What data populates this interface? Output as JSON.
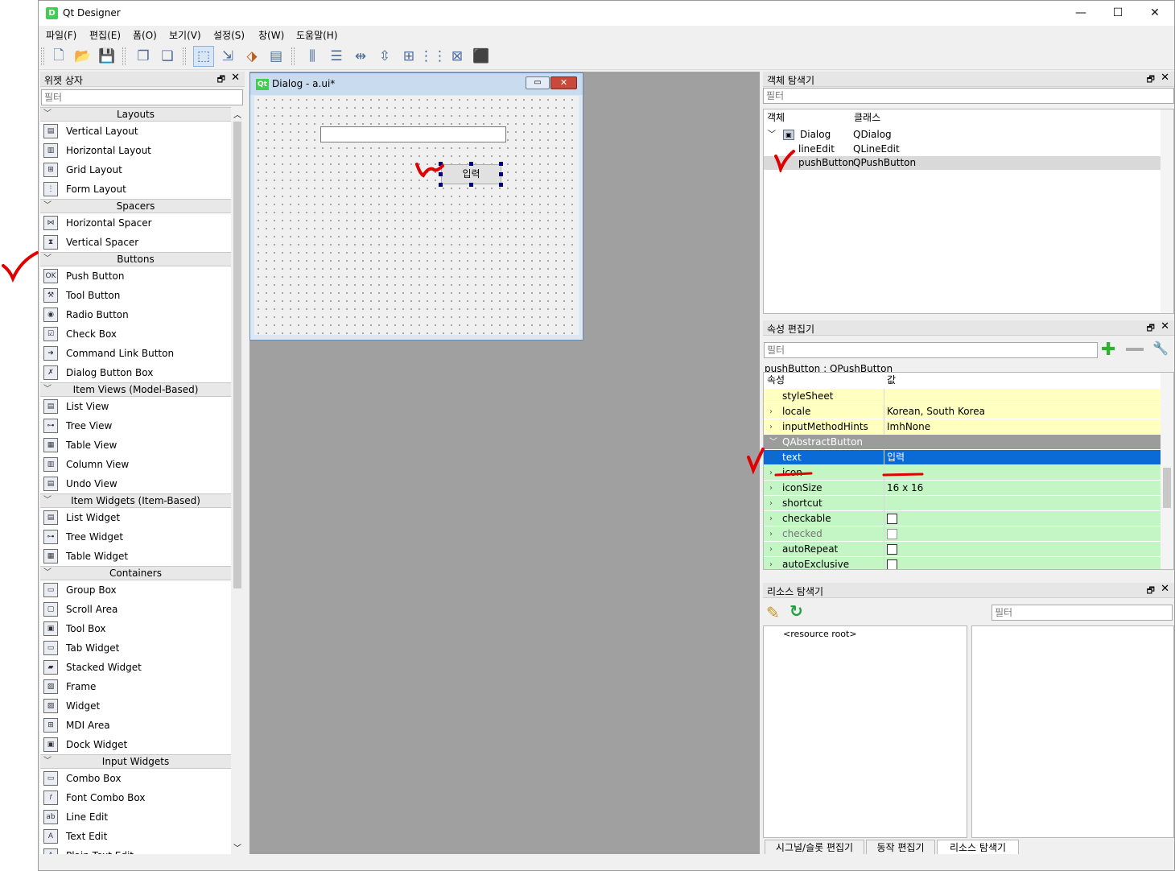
{
  "window": {
    "icon_letter": "D",
    "title": "Qt Designer",
    "controls": {
      "minimize": "—",
      "maximize": "☐",
      "close": "✕"
    }
  },
  "menu": [
    "파일(F)",
    "편집(E)",
    "폼(O)",
    "보기(V)",
    "설정(S)",
    "창(W)",
    "도움말(H)"
  ],
  "widget_box": {
    "title": "위젯 상자",
    "filter_placeholder": "필터",
    "categories": [
      {
        "name": "Layouts",
        "items": [
          "Vertical Layout",
          "Horizontal Layout",
          "Grid Layout",
          "Form Layout"
        ]
      },
      {
        "name": "Spacers",
        "items": [
          "Horizontal Spacer",
          "Vertical Spacer"
        ]
      },
      {
        "name": "Buttons",
        "items": [
          "Push Button",
          "Tool Button",
          "Radio Button",
          "Check Box",
          "Command Link Button",
          "Dialog Button Box"
        ]
      },
      {
        "name": "Item Views (Model-Based)",
        "items": [
          "List View",
          "Tree View",
          "Table View",
          "Column View",
          "Undo View"
        ]
      },
      {
        "name": "Item Widgets (Item-Based)",
        "items": [
          "List Widget",
          "Tree Widget",
          "Table Widget"
        ]
      },
      {
        "name": "Containers",
        "items": [
          "Group Box",
          "Scroll Area",
          "Tool Box",
          "Tab Widget",
          "Stacked Widget",
          "Frame",
          "Widget",
          "MDI Area",
          "Dock Widget"
        ]
      },
      {
        "name": "Input Widgets",
        "items": [
          "Combo Box",
          "Font Combo Box",
          "Line Edit",
          "Text Edit",
          "Plain Text Edit"
        ]
      }
    ]
  },
  "form": {
    "icon": "Qt",
    "title": "Dialog - a.ui*",
    "button_text": "입력",
    "min_btn": "▭",
    "close_btn": "✕"
  },
  "object_inspector": {
    "title": "객체 탐색기",
    "filter_placeholder": "필터",
    "col_object": "객체",
    "col_class": "클래스",
    "rows": [
      {
        "object": "Dialog",
        "class": "QDialog"
      },
      {
        "object": "lineEdit",
        "class": "QLineEdit"
      },
      {
        "object": "pushButton",
        "class": "QPushButton"
      }
    ]
  },
  "property_editor": {
    "title": "속성 편집기",
    "filter_placeholder": "필터",
    "object_label": "pushButton : QPushButton",
    "col_property": "속성",
    "col_value": "값",
    "rows": [
      {
        "name": "styleSheet",
        "value": ""
      },
      {
        "name": "locale",
        "value": "Korean, South Korea"
      },
      {
        "name": "inputMethodHints",
        "value": "ImhNone"
      },
      {
        "name": "QAbstractButton",
        "value": ""
      },
      {
        "name": "text",
        "value": "입력"
      },
      {
        "name": "icon",
        "value": ""
      },
      {
        "name": "iconSize",
        "value": "16 x 16"
      },
      {
        "name": "shortcut",
        "value": ""
      },
      {
        "name": "checkable",
        "value": ""
      },
      {
        "name": "checked",
        "value": ""
      },
      {
        "name": "autoRepeat",
        "value": ""
      },
      {
        "name": "autoExclusive",
        "value": ""
      }
    ]
  },
  "resource_browser": {
    "title": "리소스 탐색기",
    "filter_placeholder": "필터",
    "root": "<resource root>",
    "tabs": [
      "시그널/슬롯 편집기",
      "동작 편집기",
      "리소스 탐색기"
    ]
  },
  "colors": {
    "selection": "#0a6bd6",
    "property_yellow": "#ffffc0",
    "property_green": "#c4f5c4",
    "annotation_red": "#e00000"
  }
}
